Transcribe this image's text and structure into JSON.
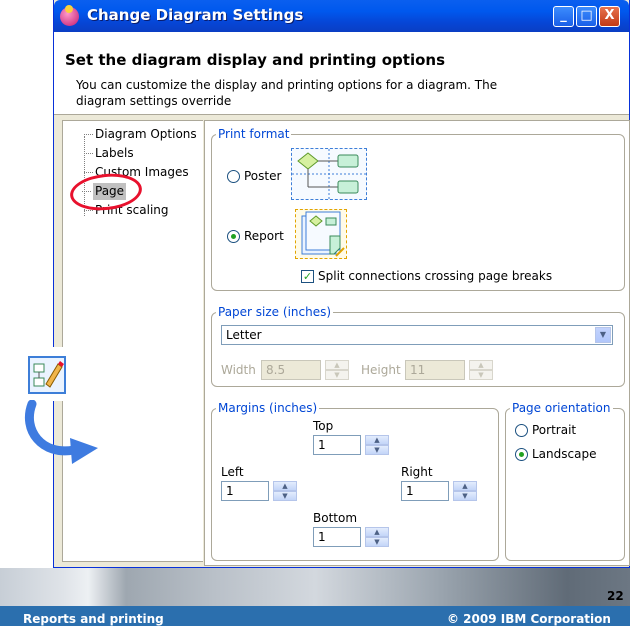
{
  "window": {
    "title": "Change Diagram Settings",
    "buttons": {
      "minimize": "_",
      "maximize": "□",
      "close": "X"
    }
  },
  "header": {
    "title": "Set the diagram display and printing options",
    "description": "You can customize the display and printing options for a diagram. The diagram settings override"
  },
  "tree": {
    "items": [
      "Diagram Options",
      "Labels",
      "Custom Images",
      "Page",
      "Print scaling"
    ],
    "selected": "Page"
  },
  "print_format": {
    "legend": "Print format",
    "poster_label": "Poster",
    "report_label": "Report",
    "selected": "Report",
    "split_label": "Split connections crossing page breaks",
    "split_checked": true
  },
  "paper_size": {
    "legend": "Paper size (inches)",
    "selected": "Letter",
    "width_label": "Width",
    "width_value": "8.5",
    "height_label": "Height",
    "height_value": "11"
  },
  "margins": {
    "legend": "Margins (inches)",
    "top_label": "Top",
    "top_value": "1",
    "left_label": "Left",
    "left_value": "1",
    "right_label": "Right",
    "right_value": "1",
    "bottom_label": "Bottom",
    "bottom_value": "1"
  },
  "orientation": {
    "legend": "Page orientation",
    "portrait_label": "Portrait",
    "landscape_label": "Landscape",
    "selected": "Landscape"
  },
  "footer": {
    "page_number": "22",
    "left_text": "Reports and printing",
    "right_text": "© 2009 IBM Corporation"
  },
  "colors": {
    "title_bar": "#0058ee",
    "legend_text": "#0046d5",
    "highlight_circle": "#e8112d",
    "footer_bar": "#2b6fae",
    "radio_dot": "#21a121"
  },
  "icons": [
    "app-icon",
    "report-edit-icon",
    "curved-arrow-icon",
    "poster-diagram-icon",
    "report-diagram-icon",
    "check-icon",
    "chevron-down-icon"
  ]
}
